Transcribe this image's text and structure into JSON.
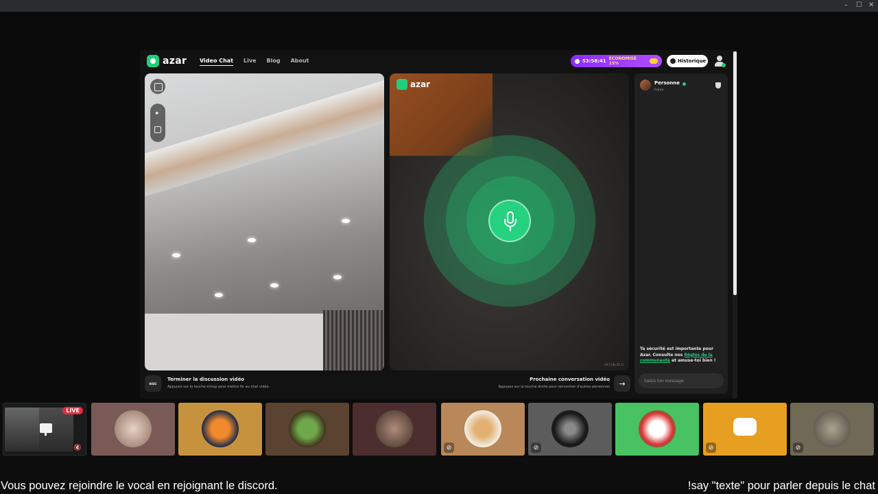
{
  "window": {
    "minimize_glyph": "–",
    "maximize_glyph": "☐",
    "close_glyph": "✕"
  },
  "app": {
    "brand": "azar",
    "nav": [
      "Video Chat",
      "Live",
      "Blog",
      "About"
    ],
    "active_nav": "Video Chat",
    "timer": "53:58:41",
    "timer_promo": "ÉCONOMISE 15%",
    "history_button": "Historique"
  },
  "remote_video": {
    "watermark": "azar",
    "version_text": "v9.2 (dv.35.1)"
  },
  "chat": {
    "partner_name": "Personne",
    "partner_country": "France",
    "safety_text_1": "Ta sécurité est importante pour Azar. Consulte nos ",
    "safety_link": "Règles de la communauté",
    "safety_text_2": " et amuse-toi bien !",
    "input_placeholder": "Saisis ton message"
  },
  "controls": {
    "esc_key": "esc",
    "end_title": "Terminer la discussion vidéo",
    "end_subtitle": "Appuyez sur la touche échap pour mettre fin au chat vidéo.",
    "next_title": "Prochaine conversation vidéo",
    "next_subtitle": "Appuyez sur la touche droite pour rencontrer d'autres personnes",
    "next_arrow": "→"
  },
  "participants": [
    {
      "id": "self",
      "badge": "LIVE",
      "bg": "#1a1b1d"
    },
    {
      "id": "p1",
      "bg": "#7a5a57",
      "muted": false
    },
    {
      "id": "p2",
      "bg": "#c7923e",
      "muted": false
    },
    {
      "id": "p3",
      "bg": "#5a4331",
      "muted": false
    },
    {
      "id": "p4",
      "bg": "#4c2e2e",
      "muted": false
    },
    {
      "id": "p5",
      "bg": "#b8875a",
      "muted": true
    },
    {
      "id": "p6",
      "bg": "#5c5c5c",
      "muted": true
    },
    {
      "id": "p7",
      "bg": "#48c262",
      "muted": false
    },
    {
      "id": "p8",
      "bg": "#e79f21",
      "muted": true
    },
    {
      "id": "p9",
      "bg": "#6f6955",
      "muted": true
    }
  ],
  "footer": {
    "left": "Vous pouvez rejoindre le vocal en rejoignant le discord.",
    "right": "!say \"texte\" pour parler depuis le chat"
  },
  "colors": {
    "accent_green": "#1fcf7b",
    "timer_purple": "#8b2bff",
    "live_red": "#e22e3d"
  }
}
